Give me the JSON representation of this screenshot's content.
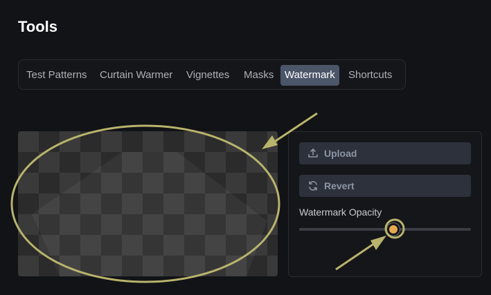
{
  "page": {
    "title": "Tools"
  },
  "tabs": [
    {
      "label": "Test Patterns",
      "active": false
    },
    {
      "label": "Curtain Warmer",
      "active": false
    },
    {
      "label": "Vignettes",
      "active": false
    },
    {
      "label": "Masks",
      "active": false
    },
    {
      "label": "Watermark",
      "active": true
    },
    {
      "label": "Shortcuts",
      "active": false
    }
  ],
  "panel": {
    "upload_label": "Upload",
    "upload_icon": "upload-icon",
    "revert_label": "Revert",
    "revert_icon": "refresh-icon",
    "opacity_label": "Watermark Opacity",
    "opacity_value": 0.55
  },
  "colors": {
    "background": "#121316",
    "active_tab": "#4c5669",
    "button": "#2c313c",
    "thumb": "#e6a951",
    "annotation": "#b9b46c"
  }
}
